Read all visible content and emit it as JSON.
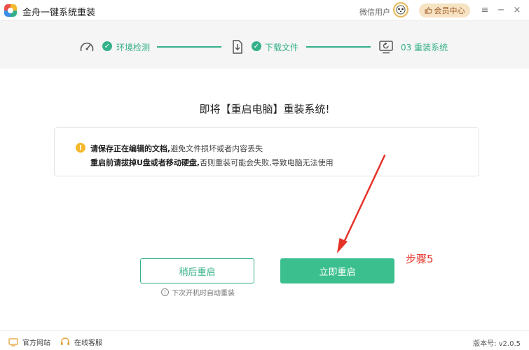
{
  "titlebar": {
    "app_title": "金舟一键系统重装",
    "wechat_user": "微信用户",
    "vip_label": "会员中心",
    "menu_icon": "≡",
    "min_icon": "−",
    "close_icon": "×"
  },
  "steps": [
    {
      "icon": "speedometer-icon",
      "label": "环境检测",
      "status": "done"
    },
    {
      "icon": "download-file-icon",
      "label": "下载文件",
      "status": "done"
    },
    {
      "icon": "monitor-restore-icon",
      "label": "03 重装系统",
      "status": "current"
    }
  ],
  "main": {
    "title": "即将【重启电脑】重装系统!",
    "notice": {
      "line1_bold": "请保存正在编辑的文档,",
      "line1_rest": "避免文件损坏或者内容丢失",
      "line2_bold": "重启前请拔掉U盘或者移动硬盘,",
      "line2_rest": "否则重装可能会失败,导致电脑无法使用"
    },
    "later_button": "稍后重启",
    "now_button": "立即重启",
    "hint": "下次开机时自动重装"
  },
  "annotation": "步骤5",
  "footer": {
    "website": "官方网站",
    "support": "在线客服",
    "version": "版本号: v2.0.5"
  },
  "colors": {
    "accent": "#34b08a",
    "button_fill": "#3bbf8f",
    "warn": "#f5b82e",
    "annotation": "#e5332a",
    "vip_bg": "#f6e3c4"
  }
}
